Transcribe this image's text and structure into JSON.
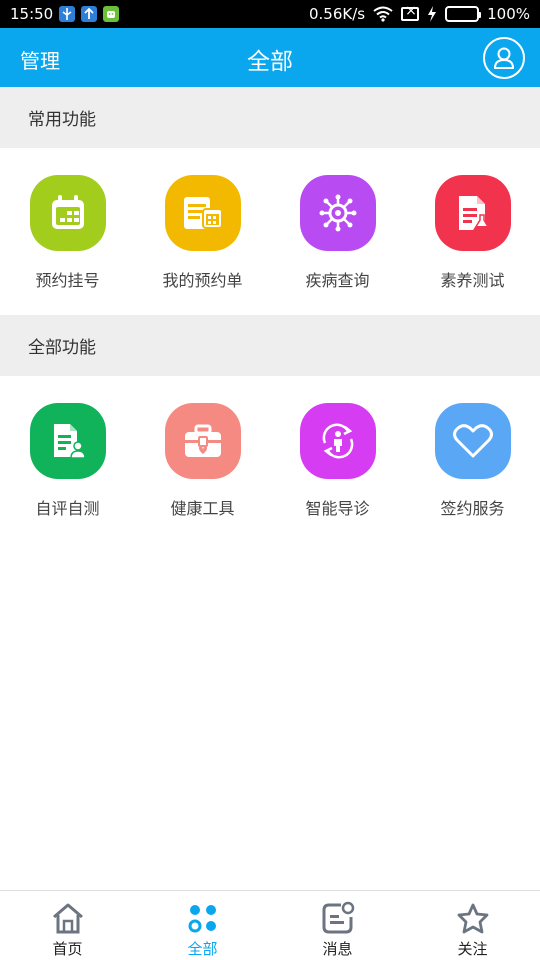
{
  "statusbar": {
    "time": "15:50",
    "net_speed": "0.56K/s",
    "battery_percent": "100%",
    "icons": [
      "usb-icon",
      "upload-icon",
      "android-icon",
      "wifi-icon",
      "no-sim-icon",
      "charging-icon",
      "battery-icon"
    ]
  },
  "header": {
    "left_label": "管理",
    "title": "全部",
    "right_icon": "user-profile-icon",
    "color": "#0aa7ef"
  },
  "sections": {
    "common": {
      "title": "常用功能",
      "items": [
        {
          "label": "预约挂号",
          "icon": "calendar-icon",
          "color": "#a3cd1d"
        },
        {
          "label": "我的预约单",
          "icon": "appointment-list-icon",
          "color": "#f2b900"
        },
        {
          "label": "疾病查询",
          "icon": "virus-icon",
          "color": "#b84cf2"
        },
        {
          "label": "素养测试",
          "icon": "document-flask-icon",
          "color": "#f2334d"
        }
      ]
    },
    "all": {
      "title": "全部功能",
      "items": [
        {
          "label": "自评自测",
          "icon": "self-test-document-icon",
          "color": "#10b35a"
        },
        {
          "label": "健康工具",
          "icon": "medical-kit-icon",
          "color": "#f58a82"
        },
        {
          "label": "智能导诊",
          "icon": "person-refresh-icon",
          "color": "#d63cf2"
        },
        {
          "label": "签约服务",
          "icon": "heart-icon",
          "color": "#5aa8f5"
        }
      ]
    }
  },
  "bottomnav": {
    "active_color": "#0aa7ef",
    "items": [
      {
        "label": "首页",
        "icon": "home-icon"
      },
      {
        "label": "全部",
        "icon": "grid-dots-icon"
      },
      {
        "label": "消息",
        "icon": "message-icon"
      },
      {
        "label": "关注",
        "icon": "star-icon"
      }
    ]
  }
}
